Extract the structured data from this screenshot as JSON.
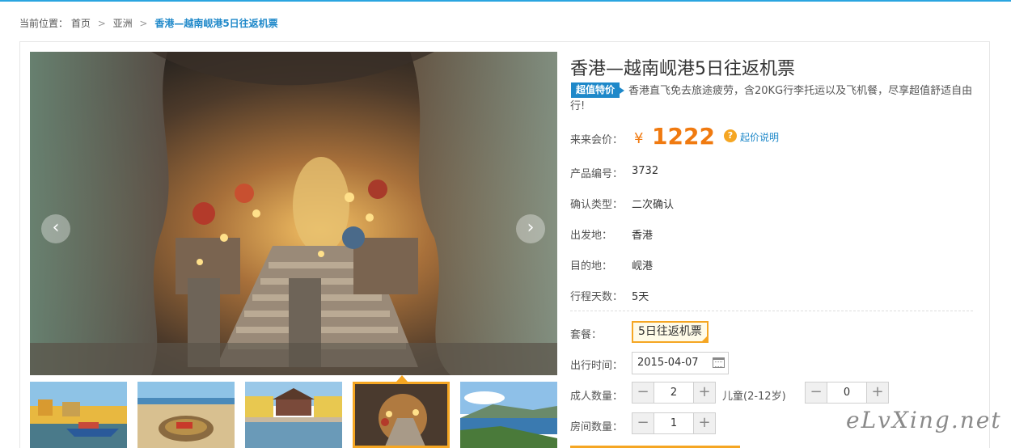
{
  "breadcrumb": {
    "prefix": "当前位置：",
    "home": "首页",
    "separator": ">",
    "region": "亚洲",
    "current": "香港—越南岘港5日往返机票"
  },
  "gallery": {
    "prev_icon": "chevron-left-icon",
    "next_icon": "chevron-right-icon",
    "thumbnails": [
      "hoi-an-river-boats",
      "beach-basket-boat",
      "japanese-bridge",
      "marble-mountain-cave",
      "coastal-bay"
    ],
    "active_thumbnail": 3,
    "accent_color": "#f5a623"
  },
  "product": {
    "title": "香港—越南岘港5日往返机票",
    "badge": "超值特价",
    "description": "香港直飞免去旅途疲劳，含20KG行李托运以及飞机餐，尽享超值舒适自由行!",
    "price_label": "来来会价：",
    "currency": "¥",
    "price": "1222",
    "price_note": "起价说明",
    "price_color": "#f07a10",
    "fields": [
      {
        "label": "产品编号：",
        "value": "3732"
      },
      {
        "label": "确认类型：",
        "value": "二次确认"
      },
      {
        "label": "出发地：",
        "value": "香港"
      },
      {
        "label": "目的地：",
        "value": "岘港"
      },
      {
        "label": "行程天数：",
        "value": "5天"
      }
    ]
  },
  "booking": {
    "package_label": "套餐：",
    "package_value": "5日往返机票",
    "date_label": "出行时间：",
    "date_value": "2015-04-07",
    "adult_label": "成人数量：",
    "adult_value": "2",
    "child_label": "儿童(2-12岁)",
    "child_value": "0",
    "room_label": "房间数量：",
    "room_value": "1",
    "minus": "−",
    "plus": "+"
  },
  "watermark": "eLvXing.net"
}
